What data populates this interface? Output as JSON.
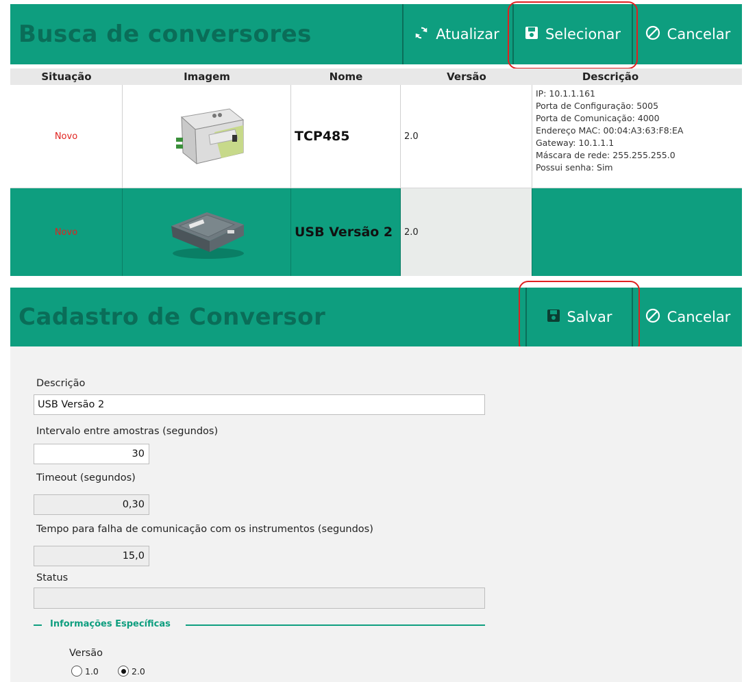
{
  "search": {
    "title": "Busca de conversores",
    "buttons": {
      "refresh": "Atualizar",
      "select": "Selecionar",
      "cancel": "Cancelar"
    },
    "columns": [
      "Situação",
      "Imagem",
      "Nome",
      "Versão",
      "Descrição"
    ],
    "rows": [
      {
        "situacao": "Novo",
        "nome": "TCP485",
        "versao": "2.0",
        "descricao": [
          "IP: 10.1.1.161",
          "Porta de Configuração: 5005",
          "Porta de Comunicação: 4000",
          "Endereço MAC: 00:04:A3:63:F8:EA",
          "Gateway: 10.1.1.1",
          "Máscara de rede: 255.255.255.0",
          "Possui senha: Sim"
        ]
      },
      {
        "situacao": "Novo",
        "nome": "USB Versão 2",
        "versao": "2.0",
        "descricao": []
      }
    ]
  },
  "register": {
    "title": "Cadastro de Conversor",
    "buttons": {
      "save": "Salvar",
      "cancel": "Cancelar"
    },
    "fields": {
      "descricao_label": "Descrição",
      "descricao_value": "USB Versão 2",
      "intervalo_label": "Intervalo entre amostras (segundos)",
      "intervalo_value": "30",
      "timeout_label": "Timeout (segundos)",
      "timeout_value": "0,30",
      "tempo_falha_label": "Tempo para falha de comunicação com os instrumentos (segundos)",
      "tempo_falha_value": "15,0",
      "status_label": "Status",
      "status_value": ""
    },
    "especificas": {
      "legend": "Informações Específicas",
      "versao_label": "Versão",
      "options": [
        "1.0",
        "2.0"
      ],
      "selected": "2.0"
    }
  },
  "colors": {
    "accent": "#0e9e7f",
    "title_text": "#0a6d58",
    "status_new": "#e0231f",
    "highlight": "#e02020"
  }
}
